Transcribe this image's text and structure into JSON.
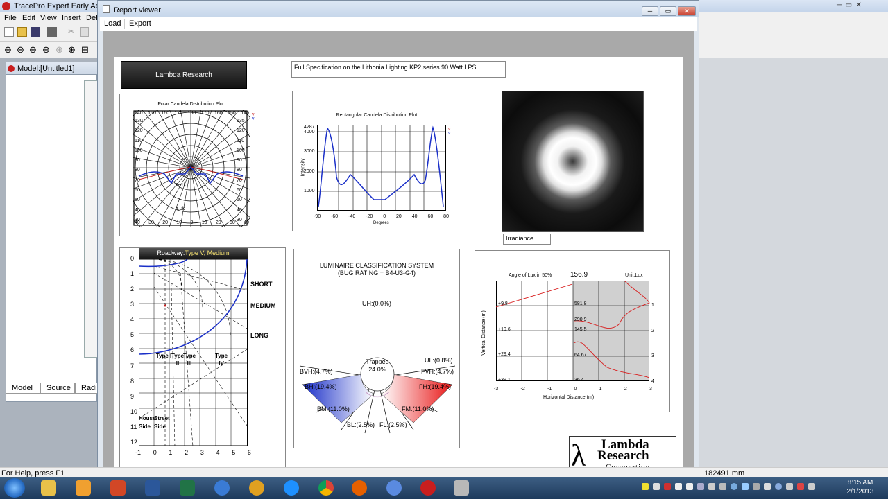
{
  "app": {
    "title": "TracePro Expert   Early Acce",
    "menu": [
      "File",
      "Edit",
      "View",
      "Insert",
      "Def"
    ],
    "model_window_title": "Model:[Untitled1]",
    "tabs": [
      "Model",
      "Source",
      "Radian"
    ],
    "status_help": "For Help, press F1",
    "status_coord": ".182491 mm"
  },
  "report_viewer": {
    "title": "Report viewer",
    "menu": [
      "Load",
      "Export"
    ],
    "logo_box_text": "Lambda Research",
    "spec_title": "Full Specification on the Lithonia Lighting KP2 series 90 Watt LPS",
    "polar": {
      "title": "Polar Candela Distribution Plot",
      "top_labels": [
        "140",
        "150",
        "160",
        "170",
        "180",
        "170",
        "160",
        "150",
        "140"
      ],
      "left_labels": [
        "130",
        "120",
        "110",
        "100",
        "90",
        "80",
        "70",
        "60",
        "50",
        "40",
        "30"
      ],
      "right_labels": [
        "135",
        "120",
        "110",
        "100",
        "90",
        "80",
        "70",
        "60",
        "50",
        "40",
        "30"
      ],
      "bottom_labels": [
        "40",
        "30",
        "20",
        "10",
        "0",
        "10",
        "20",
        "30",
        "40"
      ],
      "ring_labels": [
        "2e1k",
        "4.0k"
      ],
      "legend": [
        "v",
        "v"
      ]
    },
    "rect": {
      "title": "Rectangular Candela Distribution Plot",
      "ylabel": "Intensity",
      "xlabel": "Degrees",
      "yticks": [
        "4287",
        "4000",
        "3000",
        "2000",
        "1000"
      ],
      "xticks": [
        "-90",
        "-60",
        "-40",
        "-20",
        "0",
        "20",
        "40",
        "60",
        "80"
      ],
      "legend": [
        "v",
        "v"
      ]
    },
    "irradiance_label": "Irradiance",
    "roadway": {
      "title_prefix": "Roadway:",
      "title_type": "Type V, Medium",
      "yticks": [
        "0",
        "1",
        "2",
        "3",
        "4",
        "5",
        "6",
        "7",
        "8",
        "9",
        "10",
        "11",
        "12"
      ],
      "xticks": [
        "-1",
        "0",
        "1",
        "2",
        "3",
        "4",
        "5",
        "6"
      ],
      "zones": [
        "SHORT",
        "MEDIUM",
        "LONG"
      ],
      "types": [
        "Type I",
        "Type II",
        "Type III",
        "Type IV"
      ],
      "house_side": "House Side",
      "street_side": "Street Side"
    },
    "bug": {
      "title": "LUMINAIRE CLASSIFICATION SYSTEM",
      "rating": "(BUG RATING = B4-U3-G4)",
      "uh": "UH:(0.0%)",
      "center_label": "Trapped",
      "center_value": "24.0%",
      "ul": "UL:(0.8%)",
      "bvh": "BVH:(4.7%)",
      "fvh": "FVH:(4.7%)",
      "bh": "BH:(19.4%)",
      "fh": "FH:(19.4%)",
      "bm": "BM:(11.0%)",
      "fm": "FM:(11.0%)",
      "bl": "BL:(2.5%)",
      "fl": "FL:(2.5%)",
      "colors": {
        "back": "#1a2fc8",
        "front": "#e81818"
      }
    },
    "lux": {
      "angle_label": "Angle of Lux in 50%",
      "angle_value": "156.9",
      "unit": "Unit:Lux",
      "ylabel": "Vertical Distance (m)",
      "xlabel": "Horizontal Distance (m)",
      "left_values": [
        "+9.8",
        "+19.6",
        "+29.4",
        "+39.1"
      ],
      "inner_values": [
        "581.8",
        "290.9",
        "145.5",
        "64.67",
        "36.4"
      ],
      "right_ticks": [
        "1",
        "2",
        "3",
        "4"
      ],
      "xticks": [
        "-3",
        "-2",
        "-1",
        "0",
        "1",
        "2",
        "3"
      ]
    },
    "corp_logo": {
      "line1": "Lambda",
      "line2": "Research",
      "line3": "Corporation"
    }
  },
  "clock": {
    "time": "8:15 AM",
    "date": "2/1/2013"
  }
}
